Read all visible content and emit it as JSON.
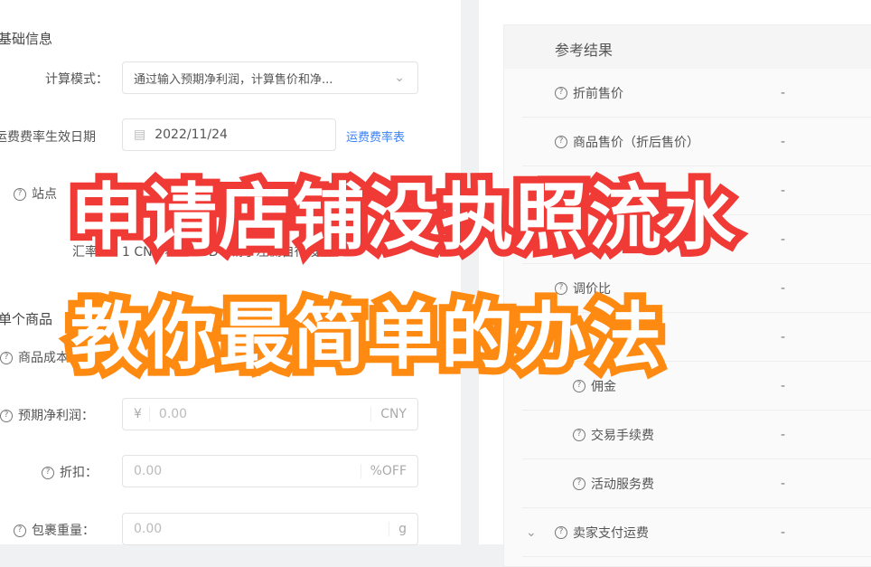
{
  "left": {
    "section_basic": "基础信息",
    "calc_mode_label": "计算模式：",
    "calc_mode_value": "通过输入预期净利润，计算售价和净...",
    "freight_date_label": "运费费率生效日期",
    "freight_date_value": "2022/11/24",
    "freight_table_link": "运费费率表",
    "site_label": "站点",
    "exchange_label": "汇率：",
    "exchange_value": "1 CNY ≈ 1 SGD（请于左侧自行设置）",
    "section_single": "单个商品",
    "cost_label": "商品成本",
    "profit_label": "预期净利润：",
    "profit_prefix": "¥",
    "profit_placeholder": "0.00",
    "profit_suffix": "CNY",
    "discount_label": "折扣：",
    "discount_placeholder": "0.00",
    "discount_suffix": "%OFF",
    "weight_label": "包裹重量：",
    "weight_placeholder": "0.00",
    "weight_suffix": "g"
  },
  "result": {
    "title": "参考结果",
    "rows": [
      {
        "label": "折前售价",
        "value": "-"
      },
      {
        "label": "商品售价（折后售价）",
        "value": "-"
      },
      {
        "label": "",
        "value": "-"
      },
      {
        "label": "",
        "value": "-"
      },
      {
        "label": "调价比",
        "value": "-"
      },
      {
        "label": "费",
        "value": "-"
      },
      {
        "label": "佣金",
        "value": "-"
      },
      {
        "label": "交易手续费",
        "value": "-"
      },
      {
        "label": "活动服务费",
        "value": "-"
      },
      {
        "label": "卖家支付运费",
        "value": "-"
      }
    ]
  },
  "overlay": {
    "line1": "申请店铺没执照流水",
    "line2": "教你最简单的办法",
    "line1_color": "#f03a36",
    "line2_color": "#ff8a12"
  }
}
